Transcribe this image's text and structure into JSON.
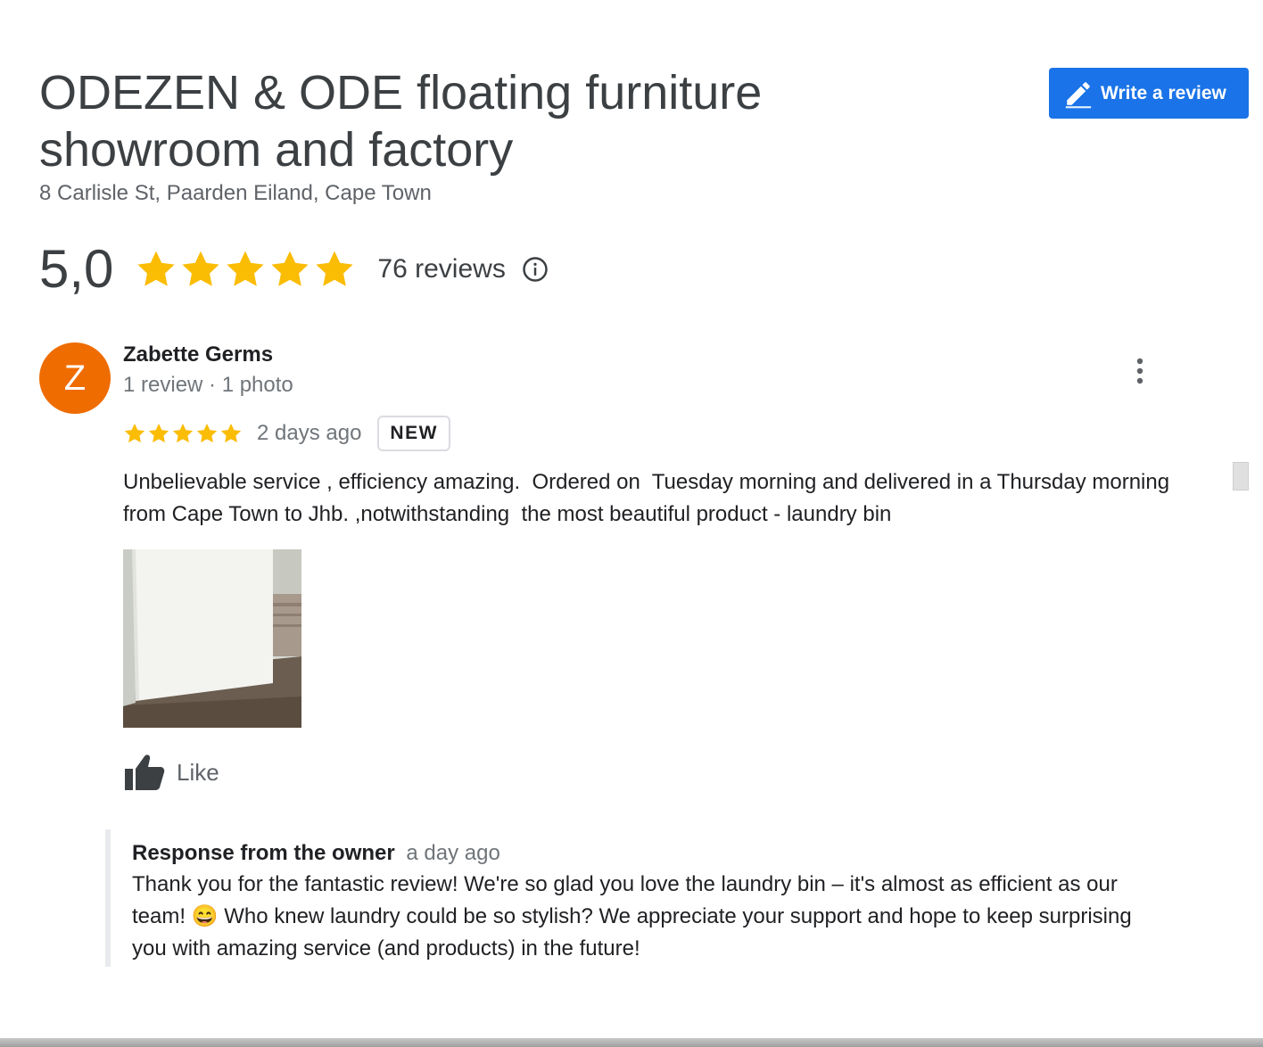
{
  "place": {
    "title": "ODEZEN & ODE floating furniture showroom and factory",
    "address": "8 Carlisle St, Paarden Eiland, Cape Town"
  },
  "header": {
    "write_review_label": "Write a review"
  },
  "summary": {
    "rating": "5,0",
    "stars": 5,
    "review_count": "76 reviews"
  },
  "review": {
    "avatar_letter": "Z",
    "avatar_color": "#ef6c00",
    "name": "Zabette Germs",
    "meta": "1 review · 1 photo",
    "stars": 5,
    "time": "2 days ago",
    "badge": "NEW",
    "text": "Unbelievable service , efficiency amazing.  Ordered on  Tuesday morning and delivered in a Thursday morning from Cape Town to Jhb. ,notwithstanding  the most beautiful product - laundry bin",
    "like_label": "Like"
  },
  "response": {
    "title": "Response from the owner",
    "time": "a day ago",
    "text": "Thank you for the fantastic review! We're so glad you love the laundry bin – it's almost as efficient as our team! 😄 Who knew laundry could be so stylish? We appreciate your support and hope to keep surprising you with amazing service (and products) in the future!"
  },
  "colors": {
    "accent": "#1a73e8",
    "star": "#fbbc04",
    "avatar": "#ef6c00"
  },
  "icons": {
    "write_review": "pencil-icon",
    "info": "info-icon",
    "more": "more-vert-icon",
    "like": "thumb-up-icon",
    "star": "star-icon"
  }
}
